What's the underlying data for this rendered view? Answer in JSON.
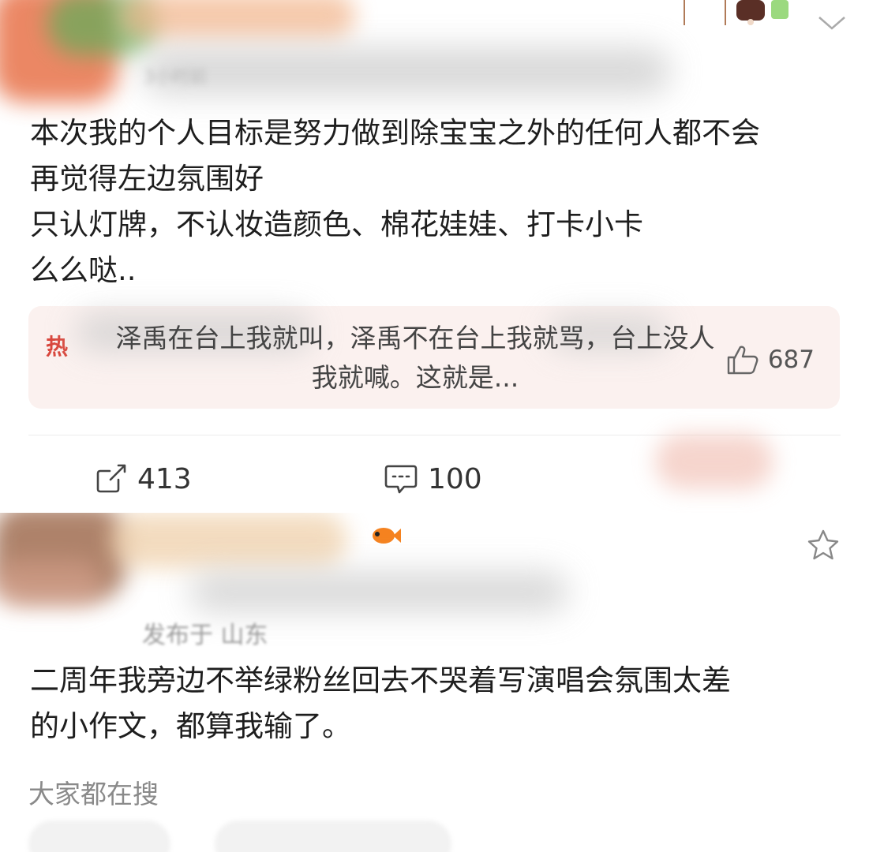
{
  "post1": {
    "time_fragment": "3小时前",
    "body": "本次我的个人目标是努力做到除宝宝之外的任何人都不会\n再觉得左边氛围好\n只认灯牌，不认妆造颜色、棉花娃娃、打卡小卡\n么么哒..",
    "hot_comment": {
      "tag": "热",
      "text": "泽禹在台上我就叫，泽禹不在台上我就骂，台上没人我就喊。这就是...",
      "likes": "687"
    },
    "actions": {
      "repost_count": "413",
      "comment_count": "100"
    },
    "icons": [
      "chevron-down-icon",
      "repost-icon",
      "comment-icon",
      "thumb-up-icon"
    ]
  },
  "post2": {
    "meta": "发布于 山东",
    "body": "二周年我旁边不举绿粉丝回去不哭着写演唱会氛围太差\n的小作文，都算我输了。",
    "search_label": "大家都在搜",
    "icons": [
      "star-icon",
      "goldfish-icon"
    ]
  }
}
